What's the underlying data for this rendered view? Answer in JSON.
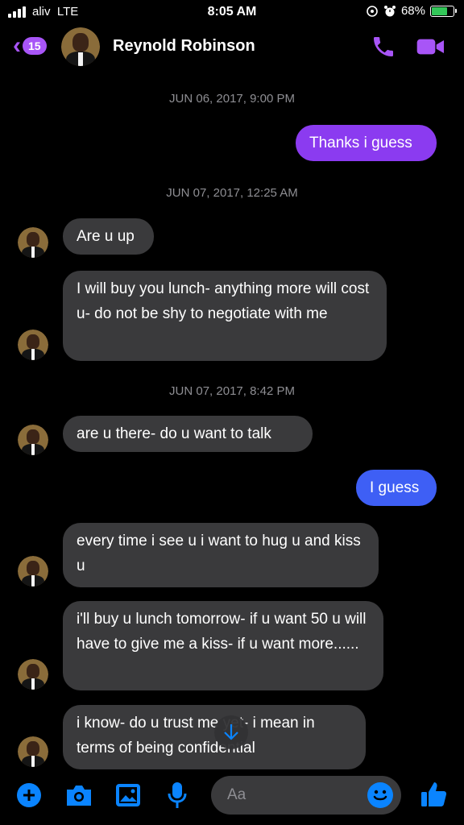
{
  "status_bar": {
    "carrier": "aliv",
    "network": "LTE",
    "time": "8:05 AM",
    "battery": "68%"
  },
  "header": {
    "back_badge": "15",
    "contact_name": "Reynold Robinson"
  },
  "messages": {
    "stamp1": "JUN 06, 2017, 9:00 PM",
    "m1": "Thanks i guess",
    "stamp2": "JUN 07, 2017, 12:25 AM",
    "m2": "Are u up",
    "m3": "I will buy you lunch- anything more will cost u- do not be shy to negotiate with me",
    "stamp3": "JUN 07, 2017, 8:42 PM",
    "m4": "are u there- do u want to talk",
    "m5": "I guess",
    "m6": "every time i see u i want to hug u and kiss u",
    "m7": "i'll buy u lunch tomorrow- if u want 50 u will have to give me a kiss- if u want more......",
    "m8": "i know- do u trust me yet- i mean in terms of being confidential"
  },
  "composer": {
    "placeholder": "Aa"
  },
  "colors": {
    "accent": "#a855f7",
    "outgoing_purple": "#8b3bf0",
    "outgoing_blue": "#3e5ff5",
    "incoming": "#3a3a3c",
    "icon_blue": "#0a84ff"
  }
}
